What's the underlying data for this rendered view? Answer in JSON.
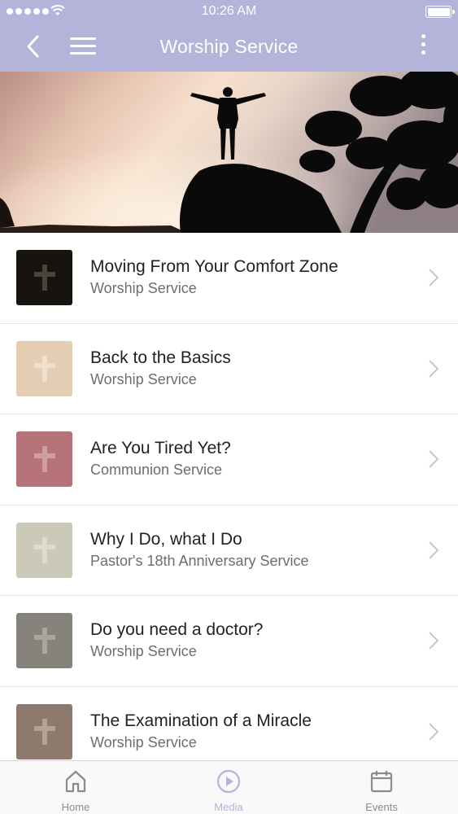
{
  "status_bar": {
    "time": "10:26 AM"
  },
  "nav": {
    "title": "Worship Service"
  },
  "sermons": [
    {
      "title": "Moving From Your Comfort Zone",
      "subtitle": "Worship Service",
      "thumb_color": "#17140f",
      "cross_color": "#4a4438"
    },
    {
      "title": "Back to the Basics",
      "subtitle": "Worship Service",
      "thumb_color": "#e3cdb3",
      "cross_color": "#efdfcc"
    },
    {
      "title": "Are You Tired Yet?",
      "subtitle": "Communion Service",
      "thumb_color": "#b7737a",
      "cross_color": "#cf9ea1"
    },
    {
      "title": "Why I Do, what I Do",
      "subtitle": "Pastor's 18th Anniversary Service",
      "thumb_color": "#cbc9b8",
      "cross_color": "#dcdbd0"
    },
    {
      "title": "Do you need a doctor?",
      "subtitle": "Worship Service",
      "thumb_color": "#85837b",
      "cross_color": "#a8a79f"
    },
    {
      "title": "The Examination of a Miracle",
      "subtitle": "Worship Service",
      "thumb_color": "#8e7a6d",
      "cross_color": "#b3a397"
    }
  ],
  "tabs": {
    "home": {
      "label": "Home",
      "color": "#8a8a8f"
    },
    "media": {
      "label": "Media",
      "color": "#b4b3d9"
    },
    "events": {
      "label": "Events",
      "color": "#8a8a8f"
    }
  },
  "colors": {
    "nav_accent": "#b4b3d9"
  }
}
